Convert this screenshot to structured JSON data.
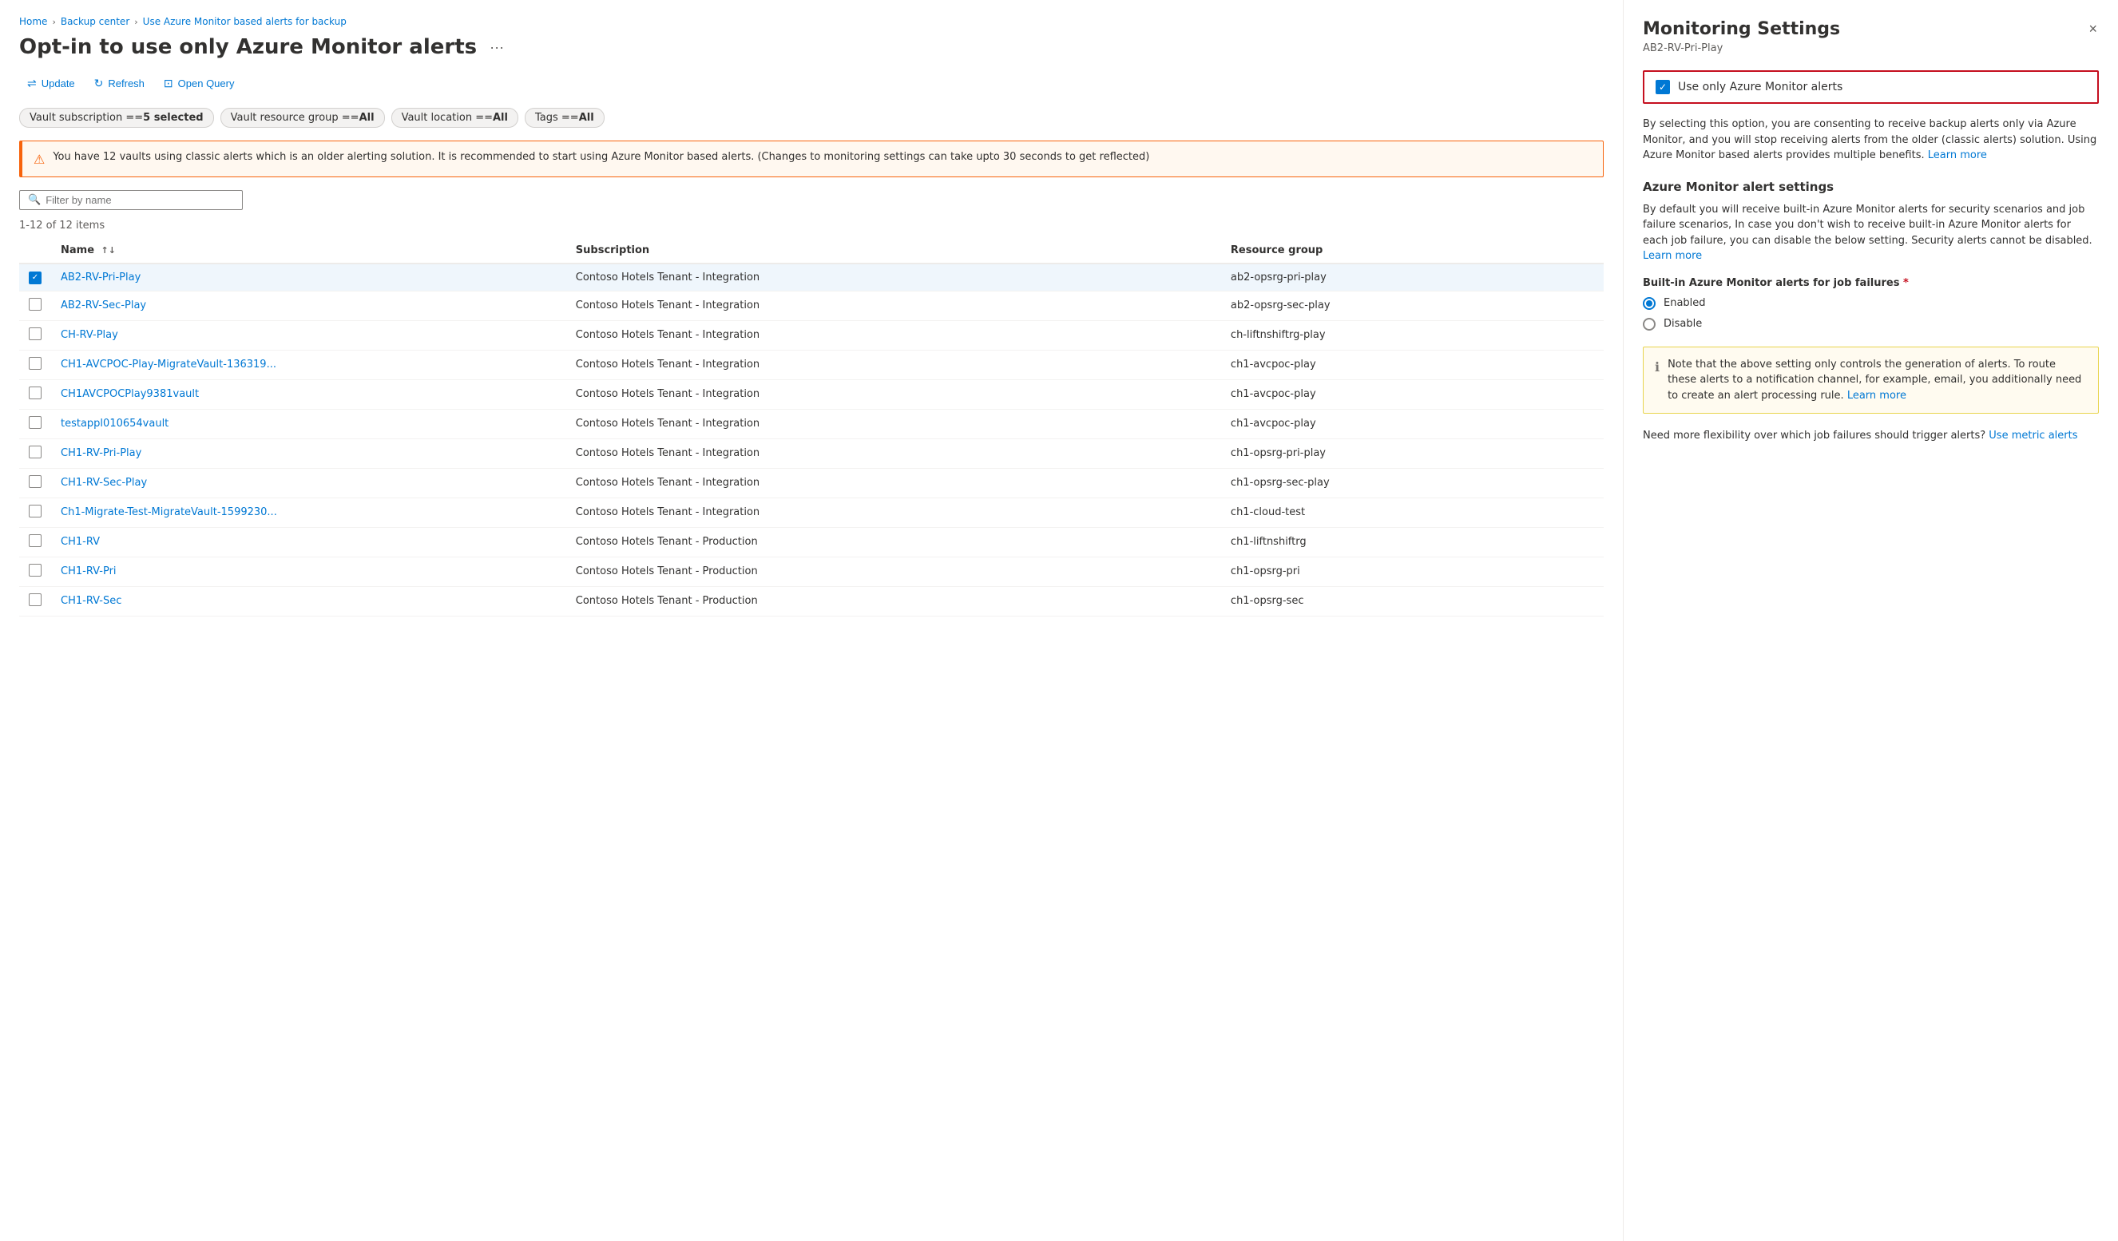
{
  "breadcrumb": {
    "items": [
      {
        "label": "Home",
        "href": "#"
      },
      {
        "label": "Backup center",
        "href": "#"
      },
      {
        "label": "Use Azure Monitor based alerts for backup",
        "href": "#",
        "active": true
      }
    ]
  },
  "page": {
    "title": "Opt-in to use only Azure Monitor alerts",
    "items_count": "1-12 of 12 items"
  },
  "toolbar": {
    "update_label": "Update",
    "refresh_label": "Refresh",
    "open_query_label": "Open Query"
  },
  "filters": [
    {
      "label": "Vault subscription == 5 selected",
      "bold_part": "5 selected"
    },
    {
      "label": "Vault resource group == All",
      "bold_part": "All"
    },
    {
      "label": "Vault location == All",
      "bold_part": "All"
    },
    {
      "label": "Tags == All",
      "bold_part": "All"
    }
  ],
  "warning": {
    "message": "You have 12 vaults using classic alerts which is an older alerting solution. It is recommended to start using Azure Monitor based alerts. (Changes to monitoring settings can take upto 30 seconds to get reflected)"
  },
  "search": {
    "placeholder": "Filter by name"
  },
  "table": {
    "columns": [
      "Name",
      "Subscription",
      "Resource group"
    ],
    "rows": [
      {
        "checked": true,
        "name": "AB2-RV-Pri-Play",
        "subscription": "Contoso Hotels Tenant - Integration",
        "resource_group": "ab2-opsrg-pri-play"
      },
      {
        "checked": false,
        "name": "AB2-RV-Sec-Play",
        "subscription": "Contoso Hotels Tenant - Integration",
        "resource_group": "ab2-opsrg-sec-play"
      },
      {
        "checked": false,
        "name": "CH-RV-Play",
        "subscription": "Contoso Hotels Tenant - Integration",
        "resource_group": "ch-liftnshiftrg-play"
      },
      {
        "checked": false,
        "name": "CH1-AVCPOC-Play-MigrateVault-136319...",
        "subscription": "Contoso Hotels Tenant - Integration",
        "resource_group": "ch1-avcpoc-play"
      },
      {
        "checked": false,
        "name": "CH1AVCPOCPlay9381vault",
        "subscription": "Contoso Hotels Tenant - Integration",
        "resource_group": "ch1-avcpoc-play"
      },
      {
        "checked": false,
        "name": "testappl010654vault",
        "subscription": "Contoso Hotels Tenant - Integration",
        "resource_group": "ch1-avcpoc-play"
      },
      {
        "checked": false,
        "name": "CH1-RV-Pri-Play",
        "subscription": "Contoso Hotels Tenant - Integration",
        "resource_group": "ch1-opsrg-pri-play"
      },
      {
        "checked": false,
        "name": "CH1-RV-Sec-Play",
        "subscription": "Contoso Hotels Tenant - Integration",
        "resource_group": "ch1-opsrg-sec-play"
      },
      {
        "checked": false,
        "name": "Ch1-Migrate-Test-MigrateVault-1599230...",
        "subscription": "Contoso Hotels Tenant - Integration",
        "resource_group": "ch1-cloud-test"
      },
      {
        "checked": false,
        "name": "CH1-RV",
        "subscription": "Contoso Hotels Tenant - Production",
        "resource_group": "ch1-liftnshiftrg"
      },
      {
        "checked": false,
        "name": "CH1-RV-Pri",
        "subscription": "Contoso Hotels Tenant - Production",
        "resource_group": "ch1-opsrg-pri"
      },
      {
        "checked": false,
        "name": "CH1-RV-Sec",
        "subscription": "Contoso Hotels Tenant - Production",
        "resource_group": "ch1-opsrg-sec"
      }
    ]
  },
  "panel": {
    "title": "Monitoring Settings",
    "subtitle": "AB2-RV-Pri-Play",
    "close_label": "×",
    "checkbox_option": {
      "label": "Use only Azure Monitor alerts",
      "checked": true
    },
    "description": "By selecting this option, you are consenting to receive backup alerts only via Azure Monitor, and you will stop receiving alerts from the older (classic alerts) solution. Using Azure Monitor based alerts provides multiple benefits.",
    "description_link": "Learn more",
    "azure_monitor_section": {
      "title": "Azure Monitor alert settings",
      "description": "By default you will receive built-in Azure Monitor alerts for security scenarios and job failure scenarios, In case you don't wish to receive built-in Azure Monitor alerts for each job failure, you can disable the below setting. Security alerts cannot be disabled.",
      "description_link": "Learn more",
      "field_label": "Built-in Azure Monitor alerts for job failures",
      "required": true,
      "options": [
        {
          "label": "Enabled",
          "selected": true
        },
        {
          "label": "Disable",
          "selected": false
        }
      ]
    },
    "note": {
      "text": "Note that the above setting only controls the generation of alerts. To route these alerts to a notification channel, for example, email, you additionally need to create an alert processing rule.",
      "link": "Learn more"
    },
    "flexibility": {
      "text": "Need more flexibility over which job failures should trigger alerts?",
      "link": "Use metric alerts"
    }
  }
}
